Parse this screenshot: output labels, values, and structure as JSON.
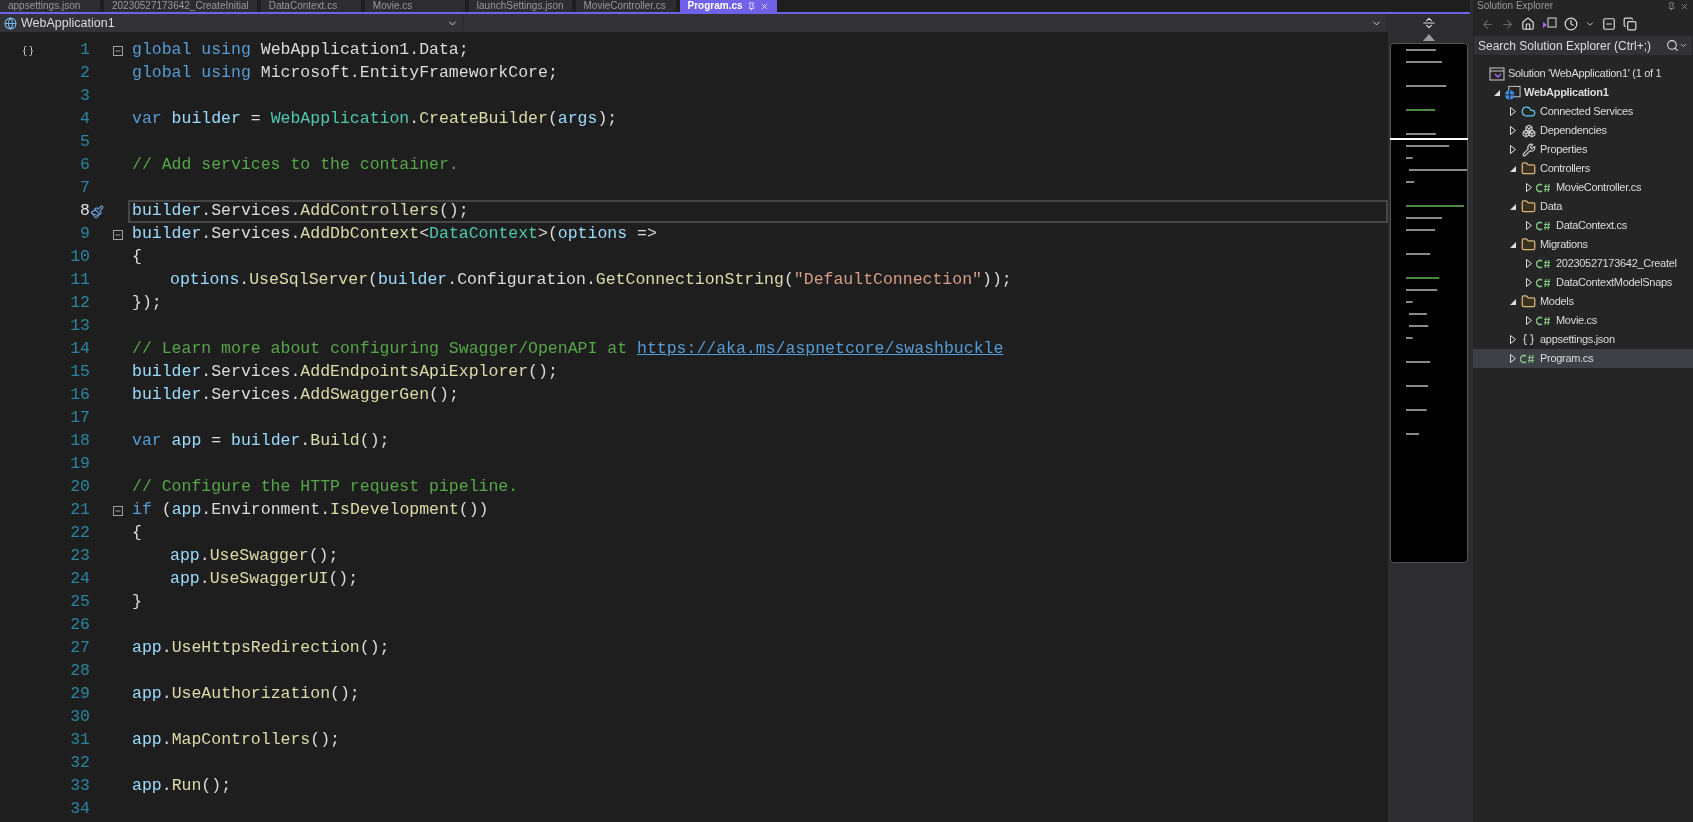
{
  "document_tabs": [
    {
      "label": "appsettings.json",
      "selected": false
    },
    {
      "label": "20230527173642_CreateInitial",
      "selected": false
    },
    {
      "label": "DataContext.cs",
      "selected": false
    },
    {
      "label": "Movie.cs",
      "selected": false
    },
    {
      "label": "launchSettings.json",
      "selected": false
    },
    {
      "label": "MovieController.cs",
      "selected": false
    },
    {
      "label": "Program.cs",
      "selected": true
    }
  ],
  "navigation_bar": {
    "project": "WebApplication1"
  },
  "editor": {
    "lines": [
      {
        "number": "1",
        "current": false,
        "collapsible": true,
        "tokens": [
          {
            "kind": "kw",
            "text": "global using "
          },
          {
            "kind": "plain",
            "text": "WebApplication1.Data;"
          }
        ]
      },
      {
        "number": "2",
        "current": false,
        "collapsible": false,
        "tokens": [
          {
            "kind": "kw",
            "text": "global using "
          },
          {
            "kind": "plain",
            "text": "Microsoft.EntityFrameworkCore;"
          }
        ]
      },
      {
        "number": "3",
        "current": false,
        "collapsible": false
      },
      {
        "number": "4",
        "current": false,
        "collapsible": false,
        "tokens": [
          {
            "kind": "kw",
            "text": "var "
          },
          {
            "kind": "var",
            "text": "builder"
          },
          {
            "kind": "plain",
            "text": " = "
          },
          {
            "kind": "type",
            "text": "WebApplication"
          },
          {
            "kind": "plain",
            "text": "."
          },
          {
            "kind": "method",
            "text": "CreateBuilder"
          },
          {
            "kind": "plain",
            "text": "("
          },
          {
            "kind": "var",
            "text": "args"
          },
          {
            "kind": "plain",
            "text": ");"
          }
        ]
      },
      {
        "number": "5",
        "current": false,
        "collapsible": false
      },
      {
        "number": "6",
        "current": false,
        "collapsible": false,
        "tokens": [
          {
            "kind": "comment",
            "text": "// Add services to the container."
          }
        ]
      },
      {
        "number": "7",
        "current": false,
        "collapsible": false
      },
      {
        "number": "8",
        "current": true,
        "collapsible": false,
        "tokens": [
          {
            "kind": "var",
            "text": "builder"
          },
          {
            "kind": "plain",
            "text": ".Services."
          },
          {
            "kind": "method",
            "text": "AddControllers"
          },
          {
            "kind": "plain",
            "text": "();"
          }
        ]
      },
      {
        "number": "9",
        "current": false,
        "collapsible": true,
        "tokens": [
          {
            "kind": "var",
            "text": "builder"
          },
          {
            "kind": "plain",
            "text": ".Services."
          },
          {
            "kind": "method",
            "text": "AddDbContext"
          },
          {
            "kind": "plain",
            "text": "<"
          },
          {
            "kind": "type",
            "text": "DataContext"
          },
          {
            "kind": "plain",
            "text": ">("
          },
          {
            "kind": "var",
            "text": "options"
          },
          {
            "kind": "plain",
            "text": " =>"
          }
        ]
      },
      {
        "number": "10",
        "current": false,
        "collapsible": false,
        "tokens": [
          {
            "kind": "plain",
            "text": "{"
          }
        ]
      },
      {
        "number": "11",
        "current": false,
        "collapsible": false,
        "indented": true,
        "tokens": [
          {
            "kind": "var",
            "text": "options"
          },
          {
            "kind": "plain",
            "text": "."
          },
          {
            "kind": "method",
            "text": "UseSqlServer"
          },
          {
            "kind": "plain",
            "text": "("
          },
          {
            "kind": "var",
            "text": "builder"
          },
          {
            "kind": "plain",
            "text": ".Configuration."
          },
          {
            "kind": "method",
            "text": "GetConnectionString"
          },
          {
            "kind": "plain",
            "text": "("
          },
          {
            "kind": "string",
            "text": "\"DefaultConnection\""
          },
          {
            "kind": "plain",
            "text": "));"
          }
        ]
      },
      {
        "number": "12",
        "current": false,
        "collapsible": false,
        "tokens": [
          {
            "kind": "plain",
            "text": "});"
          }
        ]
      },
      {
        "number": "13",
        "current": false,
        "collapsible": false
      },
      {
        "number": "14",
        "current": false,
        "collapsible": false,
        "tokens": [
          {
            "kind": "comment",
            "text": "// Learn more about configuring Swagger/OpenAPI at "
          },
          {
            "kind": "link",
            "text": "https://aka.ms/aspnetcore/swashbuckle"
          }
        ]
      },
      {
        "number": "15",
        "current": false,
        "collapsible": false,
        "tokens": [
          {
            "kind": "var",
            "text": "builder"
          },
          {
            "kind": "plain",
            "text": ".Services."
          },
          {
            "kind": "method",
            "text": "AddEndpointsApiExplorer"
          },
          {
            "kind": "plain",
            "text": "();"
          }
        ]
      },
      {
        "number": "16",
        "current": false,
        "collapsible": false,
        "tokens": [
          {
            "kind": "var",
            "text": "builder"
          },
          {
            "kind": "plain",
            "text": ".Services."
          },
          {
            "kind": "method",
            "text": "AddSwaggerGen"
          },
          {
            "kind": "plain",
            "text": "();"
          }
        ]
      },
      {
        "number": "17",
        "current": false,
        "collapsible": false
      },
      {
        "number": "18",
        "current": false,
        "collapsible": false,
        "tokens": [
          {
            "kind": "kw",
            "text": "var "
          },
          {
            "kind": "var",
            "text": "app"
          },
          {
            "kind": "plain",
            "text": " = "
          },
          {
            "kind": "var",
            "text": "builder"
          },
          {
            "kind": "plain",
            "text": "."
          },
          {
            "kind": "method",
            "text": "Build"
          },
          {
            "kind": "plain",
            "text": "();"
          }
        ]
      },
      {
        "number": "19",
        "current": false,
        "collapsible": false
      },
      {
        "number": "20",
        "current": false,
        "collapsible": false,
        "tokens": [
          {
            "kind": "comment",
            "text": "// Configure the HTTP request pipeline."
          }
        ]
      },
      {
        "number": "21",
        "current": false,
        "collapsible": true,
        "tokens": [
          {
            "kind": "kw",
            "text": "if"
          },
          {
            "kind": "plain",
            "text": " ("
          },
          {
            "kind": "var",
            "text": "app"
          },
          {
            "kind": "plain",
            "text": ".Environment."
          },
          {
            "kind": "method",
            "text": "IsDevelopment"
          },
          {
            "kind": "plain",
            "text": "())"
          }
        ]
      },
      {
        "number": "22",
        "current": false,
        "collapsible": false,
        "tokens": [
          {
            "kind": "plain",
            "text": "{"
          }
        ]
      },
      {
        "number": "23",
        "current": false,
        "collapsible": false,
        "indented": true,
        "tokens": [
          {
            "kind": "var",
            "text": "app"
          },
          {
            "kind": "plain",
            "text": "."
          },
          {
            "kind": "method",
            "text": "UseSwagger"
          },
          {
            "kind": "plain",
            "text": "();"
          }
        ]
      },
      {
        "number": "24",
        "current": false,
        "collapsible": false,
        "indented": true,
        "tokens": [
          {
            "kind": "var",
            "text": "app"
          },
          {
            "kind": "plain",
            "text": "."
          },
          {
            "kind": "method",
            "text": "UseSwaggerUI"
          },
          {
            "kind": "plain",
            "text": "();"
          }
        ]
      },
      {
        "number": "25",
        "current": false,
        "collapsible": false,
        "tokens": [
          {
            "kind": "plain",
            "text": "}"
          }
        ]
      },
      {
        "number": "26",
        "current": false,
        "collapsible": false
      },
      {
        "number": "27",
        "current": false,
        "collapsible": false,
        "tokens": [
          {
            "kind": "var",
            "text": "app"
          },
          {
            "kind": "plain",
            "text": "."
          },
          {
            "kind": "method",
            "text": "UseHttpsRedirection"
          },
          {
            "kind": "plain",
            "text": "();"
          }
        ]
      },
      {
        "number": "28",
        "current": false,
        "collapsible": false
      },
      {
        "number": "29",
        "current": false,
        "collapsible": false,
        "tokens": [
          {
            "kind": "var",
            "text": "app"
          },
          {
            "kind": "plain",
            "text": "."
          },
          {
            "kind": "method",
            "text": "UseAuthorization"
          },
          {
            "kind": "plain",
            "text": "();"
          }
        ]
      },
      {
        "number": "30",
        "current": false,
        "collapsible": false
      },
      {
        "number": "31",
        "current": false,
        "collapsible": false,
        "tokens": [
          {
            "kind": "var",
            "text": "app"
          },
          {
            "kind": "plain",
            "text": "."
          },
          {
            "kind": "method",
            "text": "MapControllers"
          },
          {
            "kind": "plain",
            "text": "();"
          }
        ]
      },
      {
        "number": "32",
        "current": false,
        "collapsible": false
      },
      {
        "number": "33",
        "current": false,
        "collapsible": false,
        "tokens": [
          {
            "kind": "var",
            "text": "app"
          },
          {
            "kind": "plain",
            "text": "."
          },
          {
            "kind": "method",
            "text": "Run"
          },
          {
            "kind": "plain",
            "text": "();"
          }
        ]
      },
      {
        "number": "34",
        "current": false,
        "collapsible": false
      }
    ]
  },
  "solution_explorer": {
    "title": "Solution Explorer",
    "search": {
      "placeholder": "Search Solution Explorer (Ctrl+;)"
    },
    "tree": [
      {
        "label": "Solution 'WebApplication1' (1 of 1",
        "kind": "solution",
        "selected": false,
        "children": [
          {
            "label": "WebApplication1",
            "kind": "project",
            "expanded": true,
            "selected": false,
            "children": [
              {
                "label": "Connected Services",
                "kind": "services",
                "expanded": false,
                "selected": false
              },
              {
                "label": "Dependencies",
                "kind": "dependencies",
                "expanded": false,
                "selected": false
              },
              {
                "label": "Properties",
                "kind": "properties",
                "expanded": false,
                "selected": false
              },
              {
                "label": "Controllers",
                "kind": "folder",
                "expanded": true,
                "selected": false,
                "children": [
                  {
                    "label": "MovieController.cs",
                    "kind": "cs",
                    "expanded": false,
                    "selected": false
                  }
                ]
              },
              {
                "label": "Data",
                "kind": "folder",
                "expanded": true,
                "selected": false,
                "children": [
                  {
                    "label": "DataContext.cs",
                    "kind": "cs",
                    "expanded": false,
                    "selected": false
                  }
                ]
              },
              {
                "label": "Migrations",
                "kind": "folder",
                "expanded": true,
                "selected": false,
                "children": [
                  {
                    "label": "20230527173642_Createl",
                    "kind": "cs",
                    "expanded": false,
                    "selected": false
                  },
                  {
                    "label": "DataContextModelSnaps",
                    "kind": "cs",
                    "expanded": false,
                    "selected": false
                  }
                ]
              },
              {
                "label": "Models",
                "kind": "folder",
                "expanded": true,
                "selected": false,
                "children": [
                  {
                    "label": "Movie.cs",
                    "kind": "cs",
                    "expanded": false,
                    "selected": false
                  }
                ]
              },
              {
                "label": "appsettings.json",
                "kind": "json",
                "expanded": false,
                "selected": false
              },
              {
                "label": "Program.cs",
                "kind": "cs",
                "expanded": false,
                "selected": true
              }
            ]
          }
        ]
      }
    ]
  }
}
